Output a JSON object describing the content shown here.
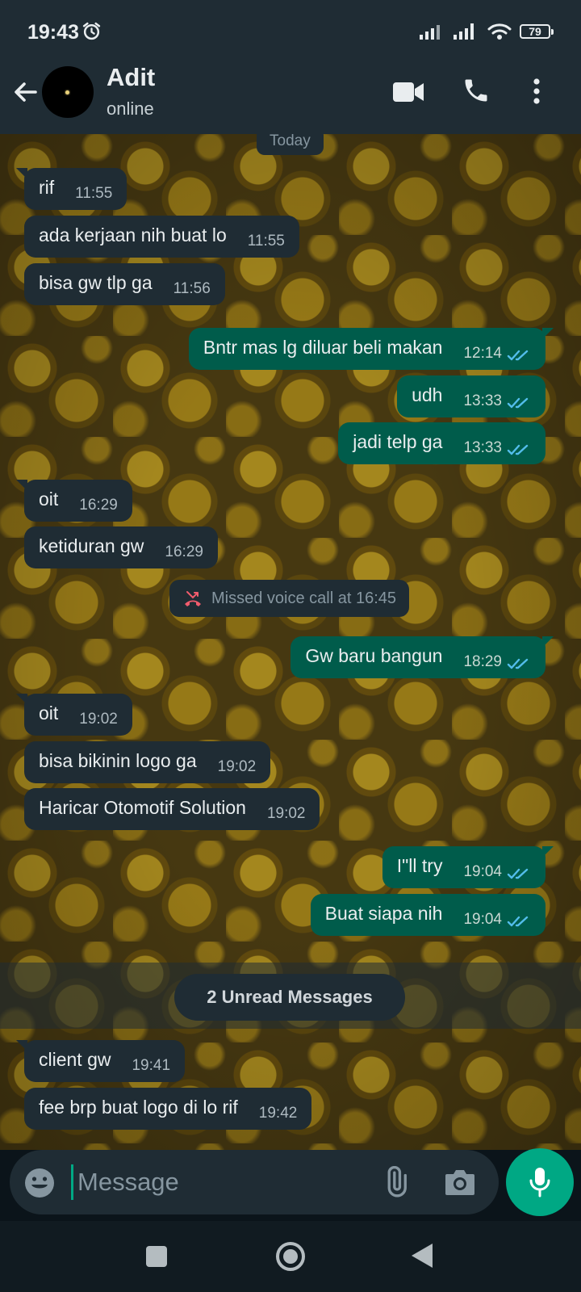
{
  "status_bar": {
    "time": "19:43",
    "battery": "79"
  },
  "header": {
    "contact_name": "Adit",
    "contact_status": "online"
  },
  "chat": {
    "day_label": "Today",
    "messages_before": [
      {
        "dir": "in",
        "text": "rif",
        "time": "11:55"
      },
      {
        "dir": "in",
        "text": "ada kerjaan nih buat lo",
        "time": "11:55"
      },
      {
        "dir": "in",
        "text": "bisa gw tlp ga",
        "time": "11:56"
      },
      {
        "dir": "out",
        "text": "Bntr mas lg diluar beli makan",
        "time": "12:14"
      },
      {
        "dir": "out",
        "text": "udh",
        "time": "13:33"
      },
      {
        "dir": "out",
        "text": "jadi telp ga",
        "time": "13:33"
      },
      {
        "dir": "in",
        "text": "oit",
        "time": "16:29"
      },
      {
        "dir": "in",
        "text": "ketiduran gw",
        "time": "16:29"
      }
    ],
    "missed_call": "Missed voice call at 16:45",
    "messages_after": [
      {
        "dir": "out",
        "text": "Gw baru bangun",
        "time": "18:29"
      },
      {
        "dir": "in",
        "text": "oit",
        "time": "19:02"
      },
      {
        "dir": "in",
        "text": "bisa bikinin logo ga",
        "time": "19:02"
      },
      {
        "dir": "in",
        "text": "Haricar Otomotif Solution",
        "time": "19:02"
      },
      {
        "dir": "out",
        "text": "I\"ll try",
        "time": "19:04"
      },
      {
        "dir": "out",
        "text": "Buat siapa nih",
        "time": "19:04"
      }
    ],
    "unread_label": "2 Unread Messages",
    "messages_unread": [
      {
        "dir": "in",
        "text": "client gw",
        "time": "19:41"
      },
      {
        "dir": "in",
        "text": "fee brp buat logo di lo rif",
        "time": "19:42"
      }
    ]
  },
  "composer": {
    "placeholder": "Message"
  },
  "colors": {
    "header": "#1f2c34",
    "incoming": "#1f2c34",
    "outgoing": "#005c4b",
    "accent": "#00a884",
    "read_ticks": "#53bdeb",
    "missed_call": "#f15c6d"
  },
  "icons": [
    "alarm-icon",
    "signal-icon",
    "wifi-icon",
    "battery-icon",
    "back-arrow-icon",
    "video-call-icon",
    "voice-call-icon",
    "more-options-icon",
    "missed-call-icon",
    "double-check-icon",
    "emoji-icon",
    "attach-icon",
    "camera-icon",
    "mic-icon",
    "recents-icon",
    "home-icon",
    "back-icon"
  ]
}
